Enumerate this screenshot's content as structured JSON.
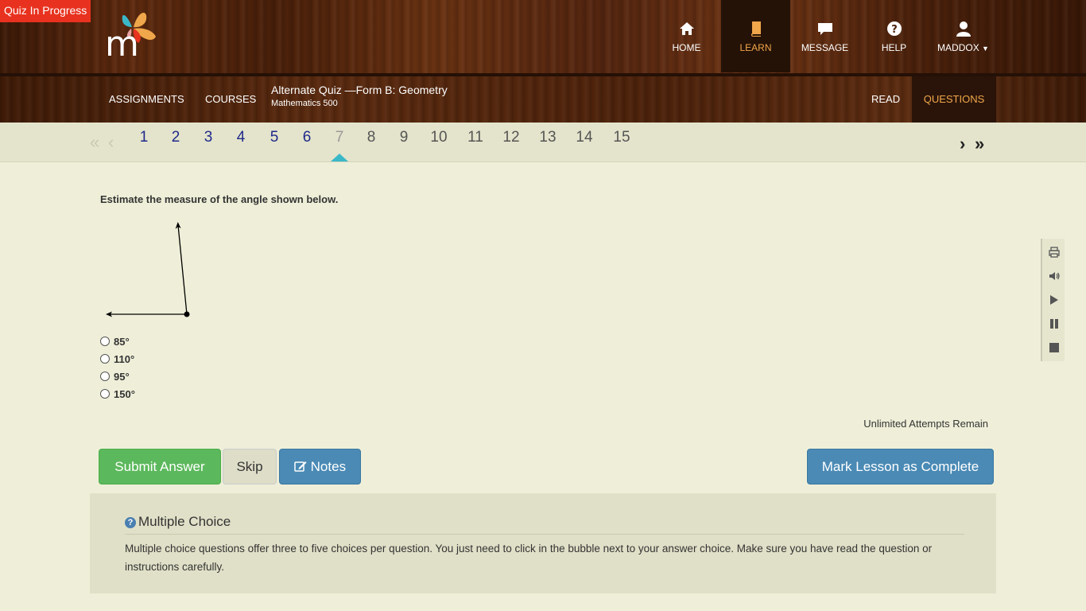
{
  "badge": "Quiz In Progress",
  "nav": [
    {
      "label": "HOME",
      "icon": "home-icon"
    },
    {
      "label": "LEARN",
      "icon": "book-icon",
      "active": true
    },
    {
      "label": "MESSAGE",
      "icon": "message-icon"
    },
    {
      "label": "HELP",
      "icon": "help-icon"
    },
    {
      "label": "MADDOX",
      "icon": "user-icon"
    }
  ],
  "subnav": {
    "assignments": "ASSIGNMENTS",
    "courses": "COURSES",
    "title": "Alternate Quiz —Form B: Geometry",
    "subtitle": "Mathematics 500",
    "read": "READ",
    "questions": "QUESTIONS"
  },
  "pager": {
    "numbers": [
      "1",
      "2",
      "3",
      "4",
      "5",
      "6",
      "7",
      "8",
      "9",
      "10",
      "11",
      "12",
      "13",
      "14",
      "15"
    ],
    "current": "7"
  },
  "question": {
    "text": "Estimate the measure of the angle shown below.",
    "choices": [
      "85°",
      "110°",
      "95°",
      "150°"
    ]
  },
  "attempts": "Unlimited Attempts Remain",
  "buttons": {
    "submit": "Submit Answer",
    "skip": "Skip",
    "notes": "Notes",
    "complete": "Mark Lesson as Complete"
  },
  "info": {
    "heading": "Multiple Choice",
    "text": "Multiple choice questions offer three to five choices per question. You just need to click in the bubble next to your answer choice. Make sure you have read the question or instructions carefully."
  },
  "colors": {
    "accent_orange": "#f0a64a",
    "submit_green": "#5cb85c",
    "button_blue": "#4a8ab5",
    "quiz_badge_red": "#e8321f",
    "page_bg": "#efefd9"
  }
}
